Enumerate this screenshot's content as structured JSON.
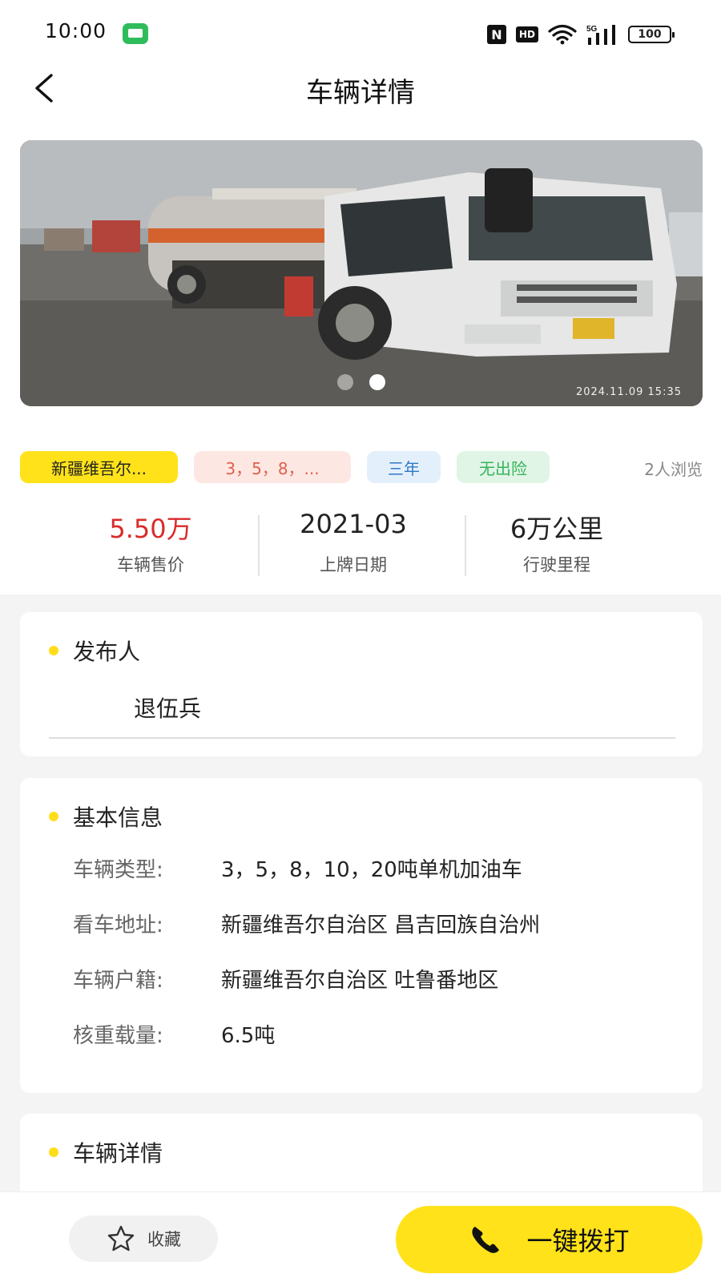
{
  "status_bar": {
    "time": "10:00",
    "nfc": "N",
    "hd": "HD",
    "network": "5G",
    "battery": "100"
  },
  "header": {
    "title": "车辆详情"
  },
  "gallery": {
    "photo_timestamp": "2024.11.09  15:35",
    "page_count": 2,
    "active_page": 2
  },
  "tags": {
    "region": "新疆维吾尔...",
    "vehicle_type": "3，5，8，...",
    "warranty": "三年",
    "accident": "无出险",
    "views": "2人浏览"
  },
  "stats": [
    {
      "value": "5.50万",
      "label": "车辆售价"
    },
    {
      "value": "2021-03",
      "label": "上牌日期"
    },
    {
      "value": "6万公里",
      "label": "行驶里程"
    }
  ],
  "publisher": {
    "title": "发布人",
    "name": "退伍兵"
  },
  "basic_info": {
    "title": "基本信息",
    "rows": [
      {
        "label": "车辆类型:",
        "value": "3，5，8，10，20吨单机加油车"
      },
      {
        "label": "看车地址:",
        "value": "新疆维吾尔自治区 昌吉回族自治州"
      },
      {
        "label": "车辆户籍:",
        "value": "新疆维吾尔自治区 吐鲁番地区"
      },
      {
        "label": "核重载量:",
        "value": "6.5吨"
      }
    ]
  },
  "details": {
    "title": "车辆详情"
  },
  "bottom_bar": {
    "favorite_label": "收藏",
    "call_label": "一键拨打"
  },
  "colors": {
    "accent_yellow": "#ffe21a",
    "price_red": "#d92b2b",
    "tag_type_text": "#e0604c",
    "tag_warranty_text": "#2f79c6",
    "tag_accident_text": "#37b35c"
  }
}
